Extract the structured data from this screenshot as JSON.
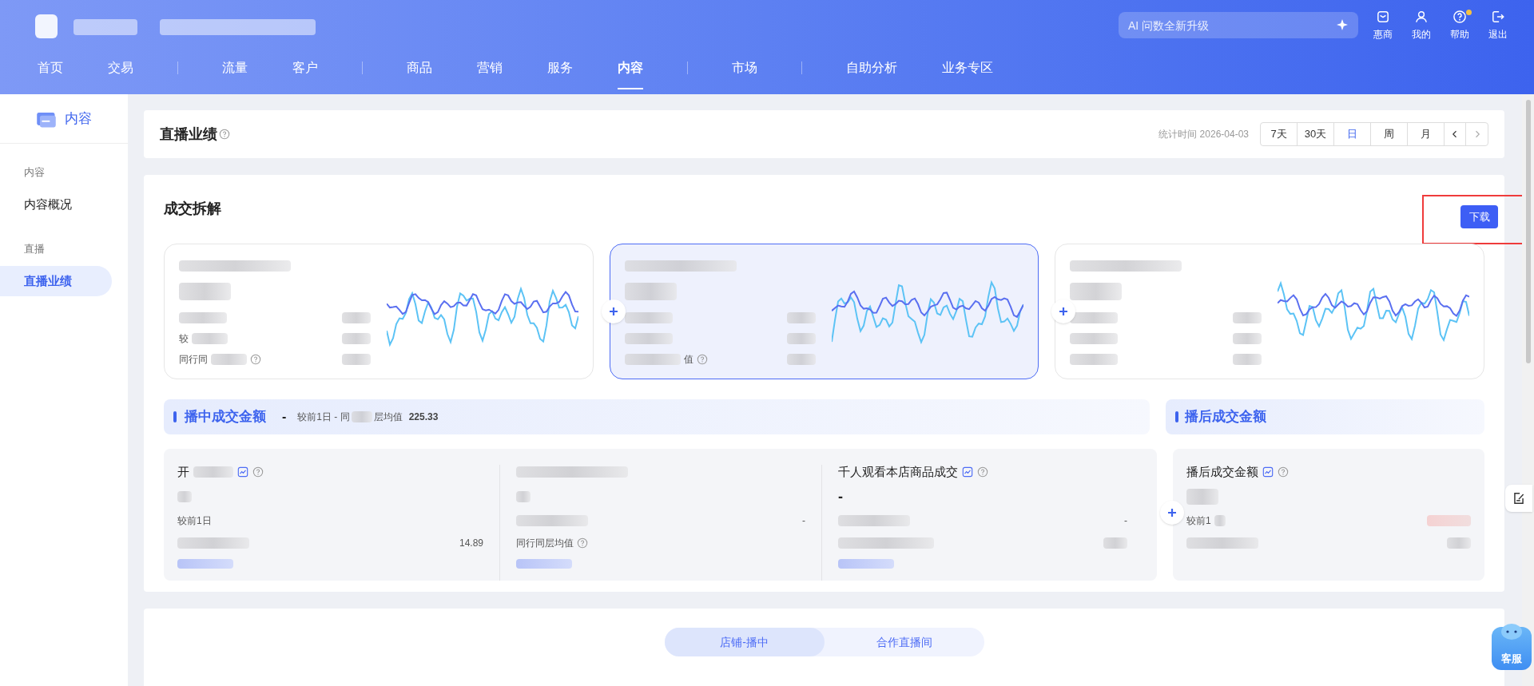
{
  "header": {
    "search": {
      "placeholder": "AI 问数全新升级"
    },
    "nav_groups": [
      [
        {
          "label": "首页",
          "selected": false
        },
        {
          "label": "交易",
          "selected": false
        }
      ],
      [
        {
          "label": "流量",
          "selected": false
        },
        {
          "label": "客户",
          "selected": false
        }
      ],
      [
        {
          "label": "商品",
          "selected": false
        },
        {
          "label": "营销",
          "selected": false
        },
        {
          "label": "服务",
          "selected": false
        },
        {
          "label": "内容",
          "selected": true
        }
      ],
      [
        {
          "label": "市场",
          "selected": false
        }
      ],
      [
        {
          "label": "自助分析",
          "selected": false
        },
        {
          "label": "业务专区",
          "selected": false
        }
      ]
    ],
    "tools": [
      {
        "kind": "mail",
        "label": "惠商",
        "badge": false
      },
      {
        "kind": "user",
        "label": "我的",
        "badge": false
      },
      {
        "kind": "help",
        "label": "帮助",
        "badge": true
      },
      {
        "kind": "logout",
        "label": "退出",
        "badge": false
      }
    ]
  },
  "sidebar": {
    "title": "内容",
    "sections": [
      {
        "heading": "内容",
        "items": [
          {
            "label": "内容概况",
            "selected": false
          }
        ]
      },
      {
        "heading": "直播",
        "items": [
          {
            "label": "直播业绩",
            "selected": true
          }
        ]
      }
    ]
  },
  "summary": {
    "title": "直播业绩",
    "stat_time": "统计时间 2026-04-03",
    "periods": [
      {
        "label": "7天",
        "selected": false
      },
      {
        "label": "30天",
        "selected": false
      },
      {
        "label": "日",
        "selected": true
      },
      {
        "label": "周",
        "selected": false
      },
      {
        "label": "月",
        "selected": false
      }
    ]
  },
  "breakdown": {
    "title": "成交拆解",
    "download": "下载",
    "metric_cards": [
      {
        "selected": false,
        "rows": [
          {
            "kind": "blurred"
          },
          {
            "kind": "prefix",
            "label": "较"
          },
          {
            "kind": "prefix",
            "label": "同行同",
            "help": true
          }
        ]
      },
      {
        "selected": true,
        "rows": [
          {
            "kind": "blurred"
          },
          {
            "kind": "blurred"
          },
          {
            "kind": "suffix",
            "label": "值",
            "help": true
          }
        ]
      },
      {
        "selected": false,
        "rows": [
          {
            "kind": "blurred"
          },
          {
            "kind": "blurred"
          },
          {
            "kind": "blurred"
          }
        ]
      }
    ],
    "live": {
      "title": "播中成交金额",
      "dash": "-",
      "compare": "较前1日 - 同",
      "compare_tail": "层均值",
      "value": "225.33",
      "columns": [
        {
          "title_parts": [
            {
              "kind": "text",
              "text": "开"
            },
            {
              "kind": "blurred"
            }
          ],
          "trend": true,
          "rows": [
            {
              "kind": "text",
              "label": "较前1日"
            },
            {
              "kind": "value",
              "value": "14.89"
            }
          ]
        },
        {
          "title_parts": [
            {
              "kind": "blurred"
            }
          ],
          "rows": [
            {
              "kind": "value",
              "value": "-"
            },
            {
              "kind": "text",
              "label": "同行同层均值",
              "help": true
            }
          ]
        },
        {
          "title_parts": [
            {
              "kind": "text",
              "text": "千人观看本店商品成交"
            }
          ],
          "trend": true,
          "main": "-",
          "rows": [
            {
              "kind": "value",
              "value": "-"
            },
            {
              "kind": "blurred"
            }
          ]
        }
      ]
    },
    "post": {
      "title": "播后成交金额",
      "panel_title": "播后成交金额",
      "compare": "较前1"
    }
  },
  "bottom_tabs": [
    {
      "label": "店铺-播中",
      "selected": true
    },
    {
      "label": "合作直播间",
      "selected": false
    }
  ],
  "support": {
    "label": "客服"
  }
}
